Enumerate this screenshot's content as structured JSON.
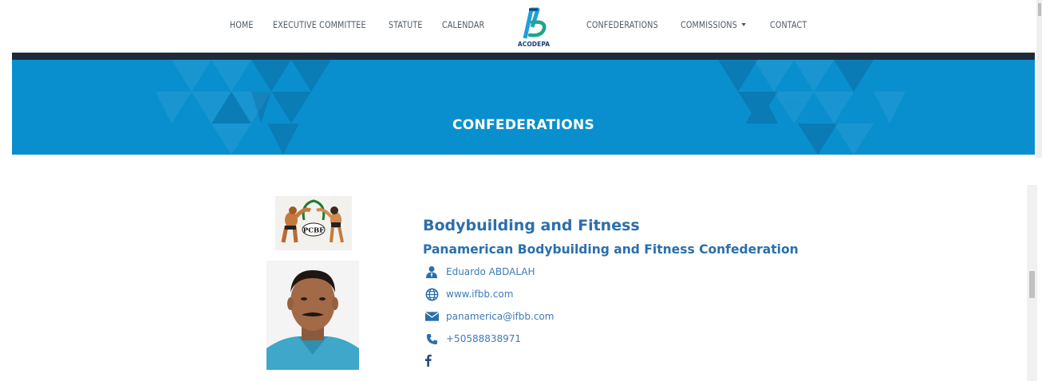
{
  "nav": {
    "left_items": [
      "HOME",
      "EXECUTIVE COMMITTEE",
      "STATUTE",
      "CALENDAR"
    ],
    "right_items": [
      "CONFEDERATIONS",
      "COMMISSIONS",
      "CONTACT"
    ],
    "logo_text": "ACODEPA"
  },
  "banner": {
    "title": "CONFEDERATIONS"
  },
  "confederation": {
    "logo_text": "PCBF",
    "category": "Bodybuilding and Fitness",
    "name": "Panamerican Bodybuilding and Fitness Confederation",
    "president": "Eduardo ABDALAH",
    "website": "www.ifbb.com",
    "email": "panamerica@ifbb.com",
    "phone": "+50588838971",
    "social": "facebook-icon"
  },
  "colors": {
    "banner_blue": "#0a8fce",
    "dark_band": "#1f2b3a",
    "heading_blue": "#2a6fad",
    "link_blue": "#3e7bb9",
    "nav_text": "#505a63"
  }
}
